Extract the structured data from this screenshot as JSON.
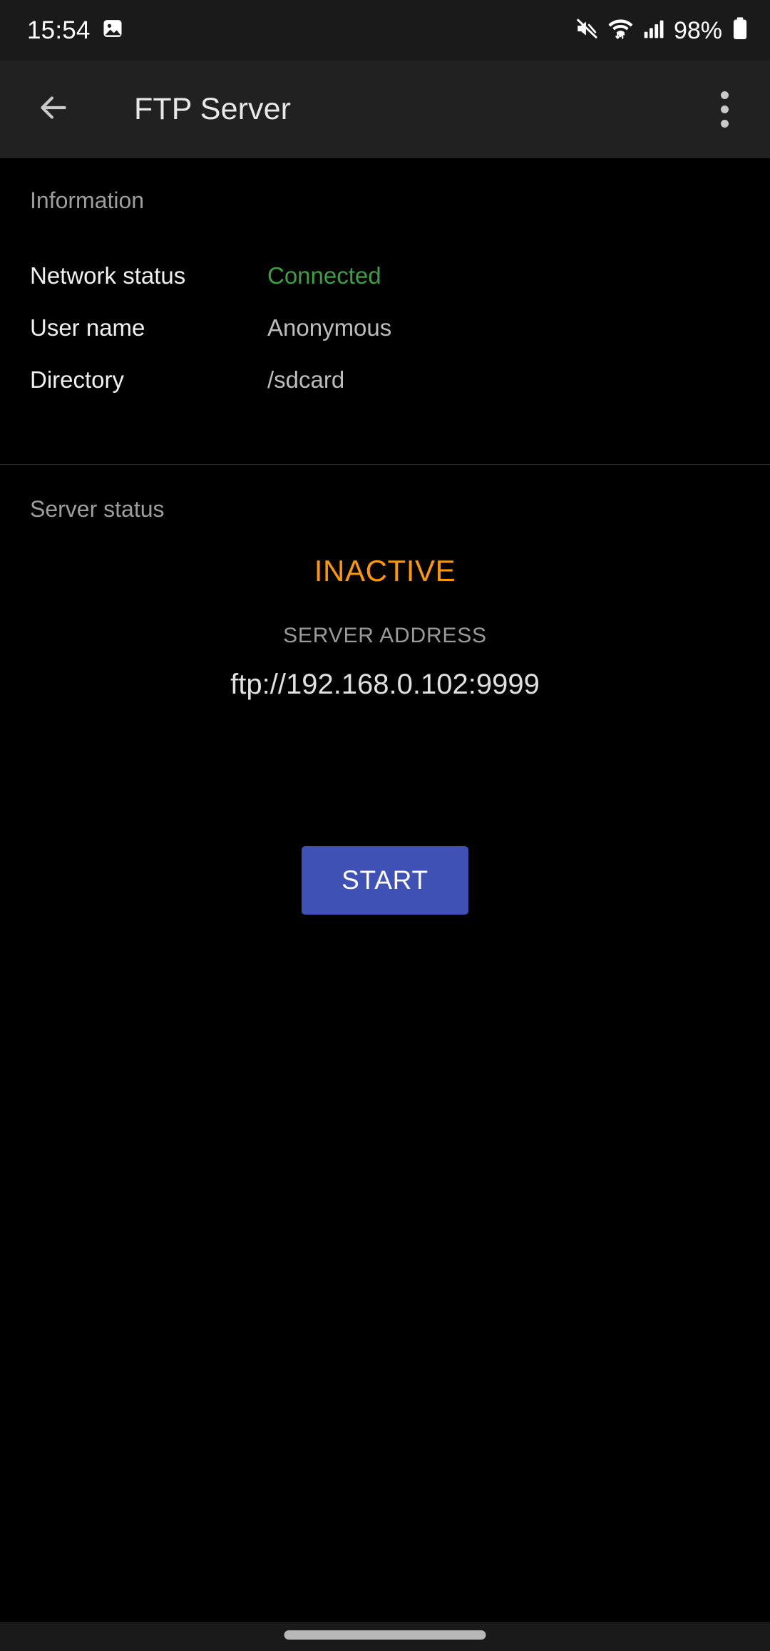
{
  "status_bar": {
    "clock": "15:54",
    "notification_icon": "image-notification-icon",
    "icons": [
      "volume-mute-icon",
      "wifi-icon",
      "cellular-signal-icon",
      "battery-icon"
    ],
    "battery_percent": "98%"
  },
  "app_bar": {
    "back_icon": "back-arrow-icon",
    "title": "FTP Server",
    "overflow_icon": "overflow-menu-icon"
  },
  "information": {
    "header": "Information",
    "rows": [
      {
        "label": "Network status",
        "value": "Connected",
        "state": "ok"
      },
      {
        "label": "User name",
        "value": "Anonymous",
        "state": "normal"
      },
      {
        "label": "Directory",
        "value": "/sdcard",
        "state": "normal"
      }
    ]
  },
  "server": {
    "header": "Server status",
    "state": "INACTIVE",
    "address_label": "SERVER ADDRESS",
    "address_value": "ftp://192.168.0.102:9999",
    "start_button_label": "START"
  },
  "nav_bar": {
    "home_indicator": "home-indicator-pill"
  },
  "colors": {
    "background": "#000000",
    "app_bar": "#212121",
    "status_bar": "#1a1a1a",
    "accent": "#3f51b5",
    "connected": "#3f9e42",
    "inactive": "#ff9800",
    "secondary_text": "#9e9e9e"
  }
}
